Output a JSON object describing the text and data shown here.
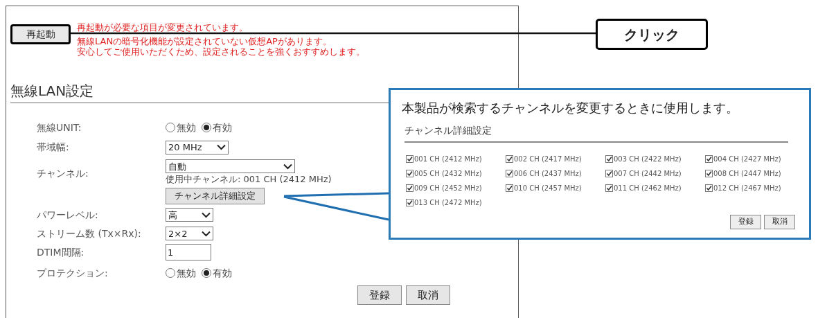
{
  "restart_button": "再起動",
  "notices": [
    "再起動が必要な項目が変更されています。",
    "無線LANの暗号化機能が設定されていない仮想APがあります。",
    "安心してご使用いただくため、設定されることを強くおすすめします。"
  ],
  "click_callout": "クリック",
  "section_title": "無線LAN設定",
  "settings": [
    {
      "kind": "radio",
      "label": "無線UNIT:",
      "options": [
        {
          "label": "無効",
          "selected": false
        },
        {
          "label": "有効",
          "selected": true
        }
      ]
    },
    {
      "kind": "select",
      "label": "帯域幅:",
      "value": "20 MHz"
    },
    {
      "kind": "channel",
      "label": "チャンネル:",
      "value": "自動",
      "note": "使用中チャンネル: 001 CH (2412 MHz)",
      "button": "チャンネル詳細設定"
    },
    {
      "kind": "select",
      "label": "パワーレベル:",
      "value": "高"
    },
    {
      "kind": "select",
      "label": "ストリーム数 (Tx×Rx):",
      "value": "2×2"
    },
    {
      "kind": "input",
      "label": "DTIM間隔:",
      "value": "1"
    },
    {
      "kind": "radio",
      "label": "プロテクション:",
      "options": [
        {
          "label": "無効",
          "selected": false
        },
        {
          "label": "有効",
          "selected": true
        }
      ]
    }
  ],
  "buttons": [
    "登録",
    "取消"
  ],
  "detail_panel": {
    "description": "本製品が検索するチャンネルを変更するときに使用します。",
    "title": "チャンネル詳細設定",
    "channels": [
      {
        "label": "001 CH (2412 MHz)",
        "checked": true
      },
      {
        "label": "002 CH (2417 MHz)",
        "checked": true
      },
      {
        "label": "003 CH (2422 MHz)",
        "checked": true
      },
      {
        "label": "004 CH (2427 MHz)",
        "checked": true
      },
      {
        "label": "005 CH (2432 MHz)",
        "checked": true
      },
      {
        "label": "006 CH (2437 MHz)",
        "checked": true
      },
      {
        "label": "007 CH (2442 MHz)",
        "checked": true
      },
      {
        "label": "008 CH (2447 MHz)",
        "checked": true
      },
      {
        "label": "009 CH (2452 MHz)",
        "checked": true
      },
      {
        "label": "010 CH (2457 MHz)",
        "checked": true
      },
      {
        "label": "011 CH (2462 MHz)",
        "checked": true
      },
      {
        "label": "012 CH (2467 MHz)",
        "checked": true
      },
      {
        "label": "013 CH (2472 MHz)",
        "checked": true
      }
    ],
    "buttons": [
      "登録",
      "取消"
    ]
  }
}
